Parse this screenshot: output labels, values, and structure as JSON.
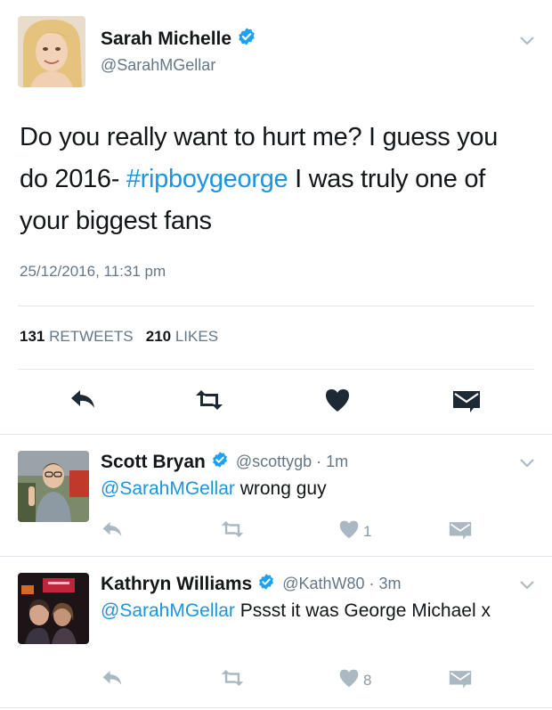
{
  "main_tweet": {
    "name": "Sarah Michelle",
    "handle": "@SarahMGellar",
    "text_parts": [
      "Do you really want to hurt me? I guess you do 2016- ",
      "#ripboygeorge",
      " I was truly one of your biggest fans"
    ],
    "timestamp": "25/12/2016, 11:31 pm",
    "retweets_count": "131",
    "retweets_label": "RETWEETS",
    "likes_count": "210",
    "likes_label": "LIKES"
  },
  "replies": [
    {
      "name": "Scott Bryan",
      "handle": "@scottygb",
      "time": "· 1m",
      "mention": "@SarahMGellar",
      "text": " wrong guy",
      "like_count": "1"
    },
    {
      "name": "Kathryn Williams",
      "handle": "@KathW80",
      "time": "· 3m",
      "mention": "@SarahMGellar",
      "text": " Pssst it was George Michael x",
      "like_count": "8"
    }
  ],
  "colors": {
    "accent": "#1b95e0",
    "verified": "#1da1f2",
    "muted": "#657786",
    "icon": "#8899a6",
    "divider": "#e1e8ed"
  },
  "icons": [
    "verified-badge-icon",
    "chevron-down-icon",
    "reply-icon",
    "retweet-icon",
    "like-heart-icon",
    "direct-message-icon"
  ]
}
